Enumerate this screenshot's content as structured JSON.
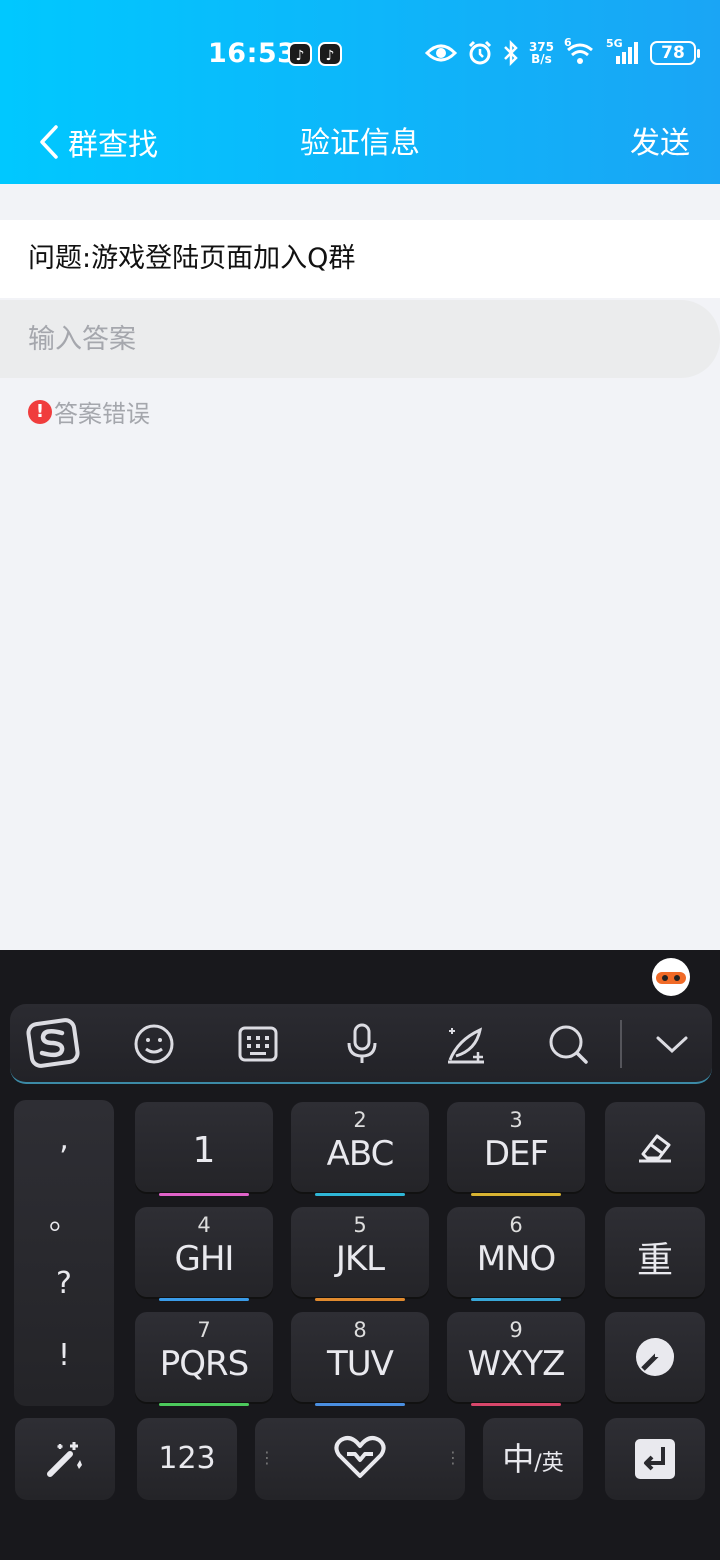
{
  "status_bar": {
    "time": "16:53",
    "net_speed_value": "375",
    "net_speed_unit": "B/s",
    "signal_label": "5G",
    "sim_label": "6",
    "battery": "78"
  },
  "navbar": {
    "back_label": "群查找",
    "title": "验证信息",
    "send_label": "发送"
  },
  "form": {
    "question": "问题:游戏登陆页面加入Q群",
    "answer_placeholder": "输入答案",
    "answer_value": "",
    "error_text": "答案错误",
    "error_icon_glyph": "!"
  },
  "keyboard": {
    "punctuation": [
      ",",
      "。",
      "?",
      "!"
    ],
    "keys": [
      {
        "num": "",
        "letters": "1"
      },
      {
        "num": "2",
        "letters": "ABC"
      },
      {
        "num": "3",
        "letters": "DEF"
      },
      {
        "num": "4",
        "letters": "GHI"
      },
      {
        "num": "5",
        "letters": "JKL"
      },
      {
        "num": "6",
        "letters": "MNO"
      },
      {
        "num": "7",
        "letters": "PQRS"
      },
      {
        "num": "8",
        "letters": "TUV"
      },
      {
        "num": "9",
        "letters": "WXYZ"
      }
    ],
    "reset_label": "重",
    "numbers_label": "123",
    "lang_main": "中",
    "lang_alt": "/英",
    "glow_colors": [
      "#e063c9",
      "#2fb6d7",
      "#d8b332",
      "#3a9be8",
      "#e08a2e",
      "#38a7d8",
      "#4cc95c",
      "#4a8ee0",
      "#d8476b"
    ],
    "accent": "#3c8aa6"
  },
  "colors": {
    "header_start": "#00c8ff",
    "header_end": "#1aa5f5",
    "error": "#f03d3d",
    "keyboard_bg": "#18181c"
  }
}
